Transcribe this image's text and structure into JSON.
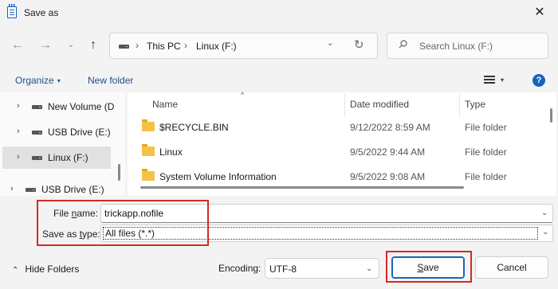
{
  "window": {
    "title": "Save as",
    "close_glyph": "✕",
    "icon": "notepad-icon"
  },
  "nav": {
    "back_glyph": "←",
    "forward_glyph": "→",
    "recent_glyph": "⌄",
    "up_glyph": "↑"
  },
  "address": {
    "parts": [
      "This PC",
      "Linux (F:)"
    ],
    "separator": "›",
    "dropdown_glyph": "⌄",
    "refresh_glyph": "↻"
  },
  "search": {
    "placeholder": "Search Linux (F:)"
  },
  "toolbar": {
    "organize_label": "Organize",
    "caret": "▾",
    "new_folder_label": "New folder",
    "help_glyph": "?"
  },
  "sidebar": {
    "chevron": "›",
    "items": [
      {
        "label": "New Volume (D",
        "selected": false
      },
      {
        "label": "USB Drive (E:)",
        "selected": false
      },
      {
        "label": "Linux (F:)",
        "selected": true
      },
      {
        "label": "USB Drive (E:)",
        "selected": false
      }
    ]
  },
  "file_list": {
    "sort_indicator": "^",
    "columns": [
      "Name",
      "Date modified",
      "Type"
    ],
    "rows": [
      {
        "name": "$RECYCLE.BIN",
        "date": "9/12/2022 8:59 AM",
        "type": "File folder"
      },
      {
        "name": "Linux",
        "date": "9/5/2022 9:44 AM",
        "type": "File folder"
      },
      {
        "name": "System Volume Information",
        "date": "9/5/2022 9:08 AM",
        "type": "File folder"
      }
    ]
  },
  "form": {
    "filename_label_pre": "File ",
    "filename_label_key": "n",
    "filename_label_post": "ame:",
    "filename_value": "trickapp.nofile",
    "savetype_label_pre": "Save as ",
    "savetype_label_key": "t",
    "savetype_label_post": "ype:",
    "savetype_value": "All files  (*.*)",
    "dropdown_glyph": "⌄"
  },
  "footer": {
    "hide_folders_caret": "⌃",
    "hide_folders_label": "Hide Folders",
    "encoding_label": "Encoding:",
    "encoding_value": "UTF-8",
    "save_key": "S",
    "save_rest": "ave",
    "cancel_label": "Cancel"
  },
  "colors": {
    "accent": "#1565c0",
    "highlight": "#d62828",
    "folder": "#f4c247"
  }
}
